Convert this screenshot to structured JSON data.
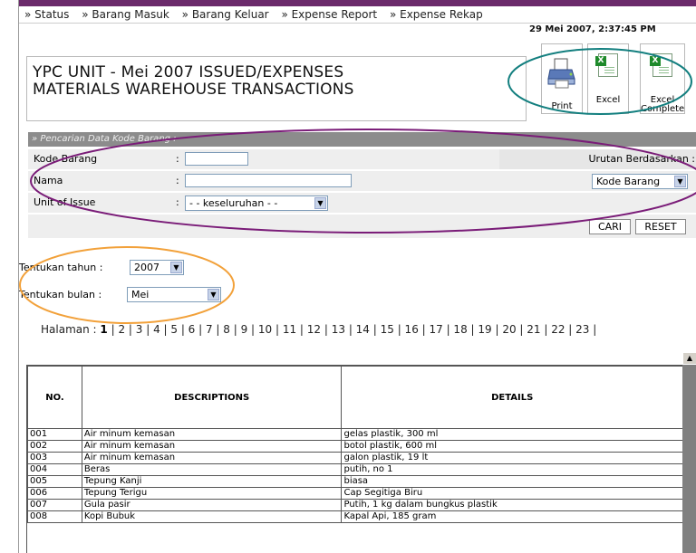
{
  "nav": [
    "» Status",
    "» Barang Masuk",
    "» Barang Keluar",
    "» Expense Report",
    "» Expense Rekap"
  ],
  "datetime": "29 Mei 2007, 2:37:45 PM",
  "title": {
    "line1": "YPC UNIT - Mei 2007 ISSUED/EXPENSES",
    "line2": "MATERIALS WAREHOUSE TRANSACTIONS"
  },
  "tools": {
    "print": "Print",
    "excel": "Excel",
    "excel_complete_1": "Excel",
    "excel_complete_2": "Complete",
    "xl_glyph": "X"
  },
  "search": {
    "header": "» Pencarian Data Kode Barang :",
    "kode_label": "Kode Barang",
    "nama_label": "Nama",
    "unit_label": "Unit of Issue",
    "colon": ":",
    "unit_value": "- - keseluruhan - -",
    "sort_label": "Urutan Berdasarkan :",
    "sort_value": "Kode Barang",
    "cari": "CARI",
    "reset": "RESET"
  },
  "filters": {
    "tahun_label": "Tentukan tahun :",
    "tahun_value": "2007",
    "bulan_label": "Tentukan bulan :",
    "bulan_value": "Mei"
  },
  "pager": {
    "label": "Halaman :",
    "current": "1",
    "pages": "| 2 | 3 | 4 | 5 | 6 | 7 | 8 | 9 | 10 | 11 | 12 | 13 | 14 | 15 | 16 | 17 | 18 | 19 | 20 | 21 | 22 | 23 |"
  },
  "table": {
    "headers": [
      "NO.",
      "DESCRIPTIONS",
      "DETAILS"
    ],
    "rows": [
      [
        "001",
        "Air minum kemasan",
        "gelas plastik, 300 ml"
      ],
      [
        "002",
        "Air minum kemasan",
        "botol plastik, 600 ml"
      ],
      [
        "003",
        "Air minum kemasan",
        "galon plastik, 19 lt"
      ],
      [
        "004",
        "Beras",
        "putih, no 1"
      ],
      [
        "005",
        "Tepung Kanji",
        "biasa"
      ],
      [
        "006",
        "Tepung Terigu",
        "Cap Segitiga Biru"
      ],
      [
        "007",
        "Gula pasir",
        "Putih, 1 kg dalam bungkus plastik"
      ],
      [
        "008",
        "Kopi Bubuk",
        "Kapal Api, 185 gram"
      ]
    ]
  },
  "colors": {
    "annotation_teal": "#137f7f",
    "annotation_purple": "#7a1c78",
    "annotation_orange": "#f2a13a",
    "search_header": "#8c8c8c"
  }
}
